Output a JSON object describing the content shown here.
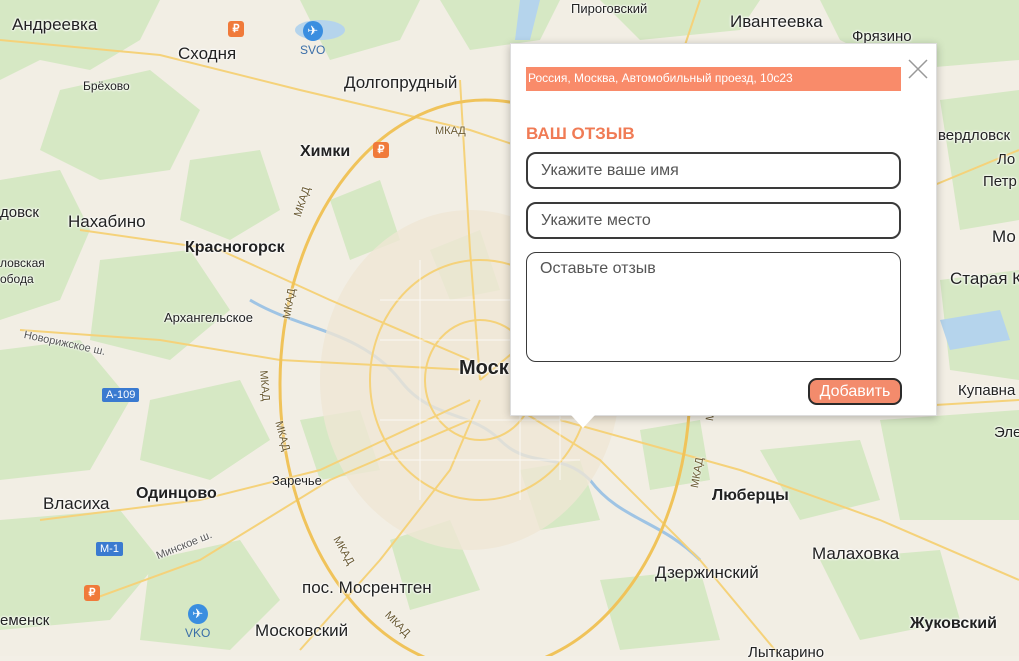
{
  "map": {
    "cities": {
      "andreevka": "Андреевка",
      "skhodnya": "Сходня",
      "brekhovo": "Брёхово",
      "dolgoprudny": "Долгопрудный",
      "pirogovsky": "Пироговский",
      "ivanteevka": "Ивантеевка",
      "fryazino": "Фрязино",
      "khimki": "Химки",
      "nakhabino": "Нахабино",
      "krasnogorsk": "Красногорск",
      "arkhangelskoe": "Архангельское",
      "moscow": "Моск",
      "vlasikha": "Власиха",
      "odintsovo": "Одинцово",
      "zarechye": "Заречье",
      "mosrentgen": "пос. Мосрентген",
      "moskovsky": "Московский",
      "lyubertsy": "Люберцы",
      "malakhovka": "Малаховка",
      "dzerzhinsky": "Дзержинский",
      "zhukovsky": "Жуковский",
      "lytkarino": "Лыткарино",
      "sverdlovsky": "вердловск",
      "petrovskoe": "Петр",
      "mo": "Мо",
      "staraya": "Старая К",
      "kupavna": "Купавна",
      "el": "Эле",
      "lo": "Ло",
      "dovsk": "довск",
      "lovskaya": "ловская",
      "boda": "обода",
      "emensk": "еменск",
      "novorizhskoe": "Новорижское ш.",
      "minskoe": "Минское ш."
    },
    "roads": {
      "mkad": "МКАД",
      "a109": "А-109",
      "m1": "М-1"
    },
    "airports": {
      "svo": "SVO",
      "vko": "VKO"
    },
    "poi_symbol": "₽"
  },
  "popup": {
    "address": "Россия, Москва, Автомобильный проезд, 10с23",
    "title": "ВАШ ОТЗЫВ",
    "name_placeholder": "Укажите ваше имя",
    "place_placeholder": "Укажите место",
    "review_placeholder": "Оставьте отзыв",
    "submit_label": "Добавить",
    "accent_color": "#f98b6a"
  }
}
